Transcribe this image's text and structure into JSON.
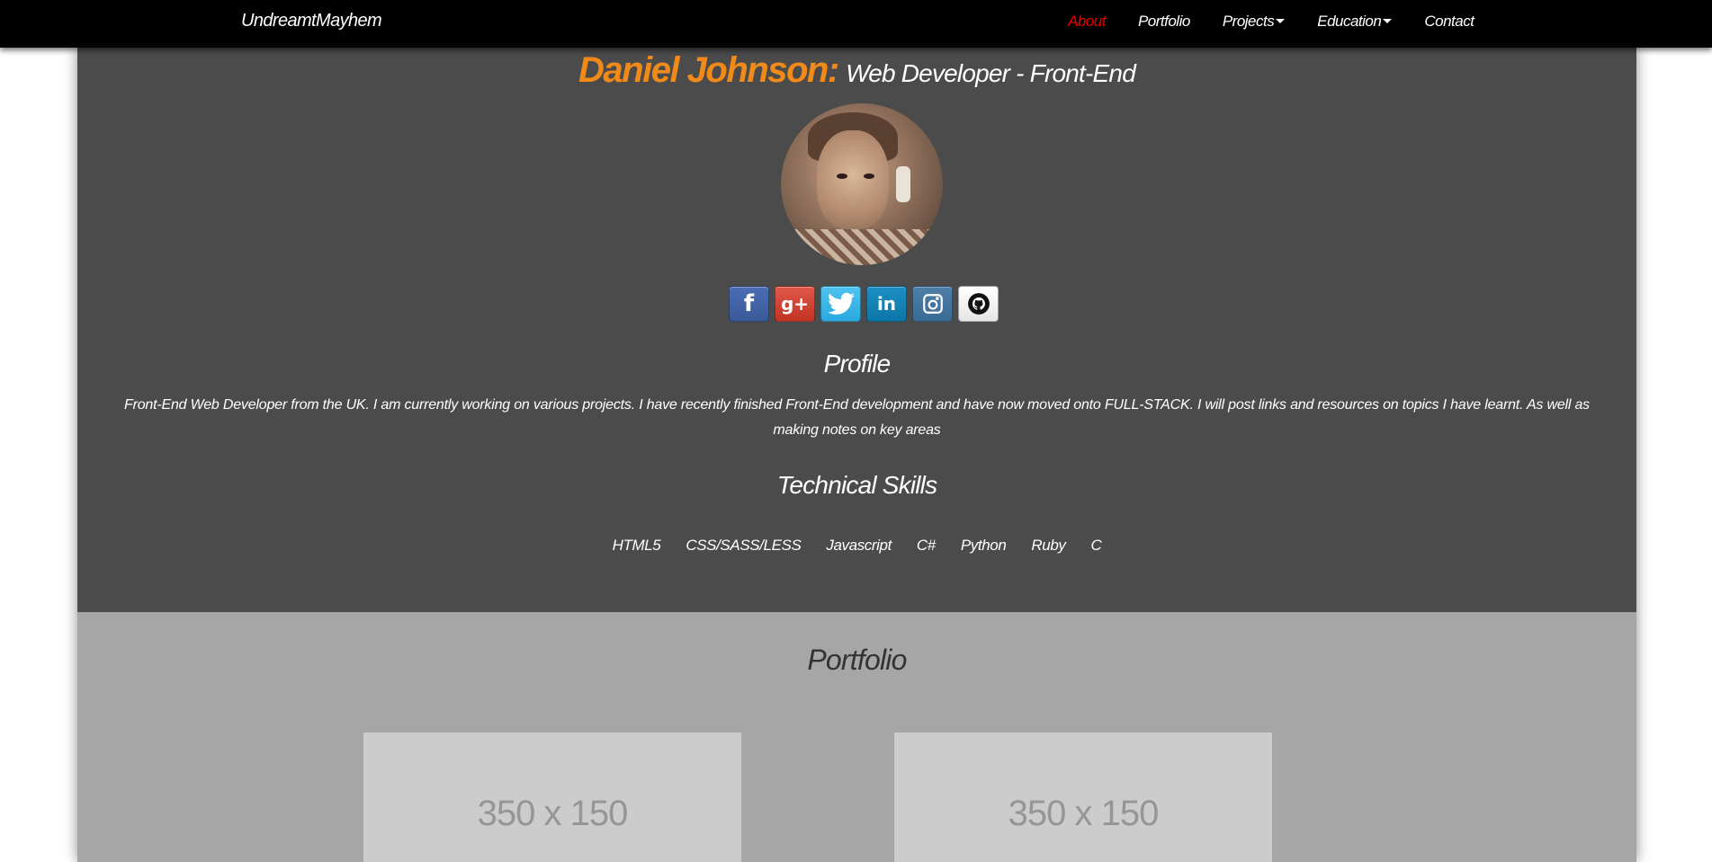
{
  "navbar": {
    "brand": "UndreamtMayhem",
    "items": [
      {
        "label": "About",
        "active": true
      },
      {
        "label": "Portfolio"
      },
      {
        "label": "Projects",
        "dropdown": true
      },
      {
        "label": "Education",
        "dropdown": true
      },
      {
        "label": "Contact"
      }
    ]
  },
  "header": {
    "name": "Daniel Johnson:",
    "role": "Web Developer - Front-End"
  },
  "social": [
    {
      "icon": "facebook-icon",
      "glyph": "f"
    },
    {
      "icon": "google-plus-icon",
      "glyph": "g+"
    },
    {
      "icon": "twitter-icon",
      "glyph": ""
    },
    {
      "icon": "linkedin-icon",
      "glyph": "in"
    },
    {
      "icon": "instagram-icon",
      "glyph": ""
    },
    {
      "icon": "github-icon",
      "glyph": ""
    }
  ],
  "profile": {
    "heading": "Profile",
    "text": "Front-End Web Developer from the UK. I am currently working on various projects. I have recently finished Front-End development and have now moved onto FULL-STACK. I will post links and resources on topics I have learnt. As well as making notes on key areas"
  },
  "skills": {
    "heading": "Technical Skills",
    "items": [
      "HTML5",
      "CSS/SASS/LESS",
      "Javascript",
      "C#",
      "Python",
      "Ruby",
      "C"
    ]
  },
  "portfolio": {
    "heading": "Portfolio",
    "cards": [
      {
        "placeholder": "350 x 150"
      },
      {
        "placeholder": "350 x 150"
      }
    ]
  },
  "colors": {
    "accent": "#f28a1a",
    "active_nav": "#e60000",
    "about_bg": "#4b4b4b",
    "portfolio_bg": "#a6a6a6"
  }
}
